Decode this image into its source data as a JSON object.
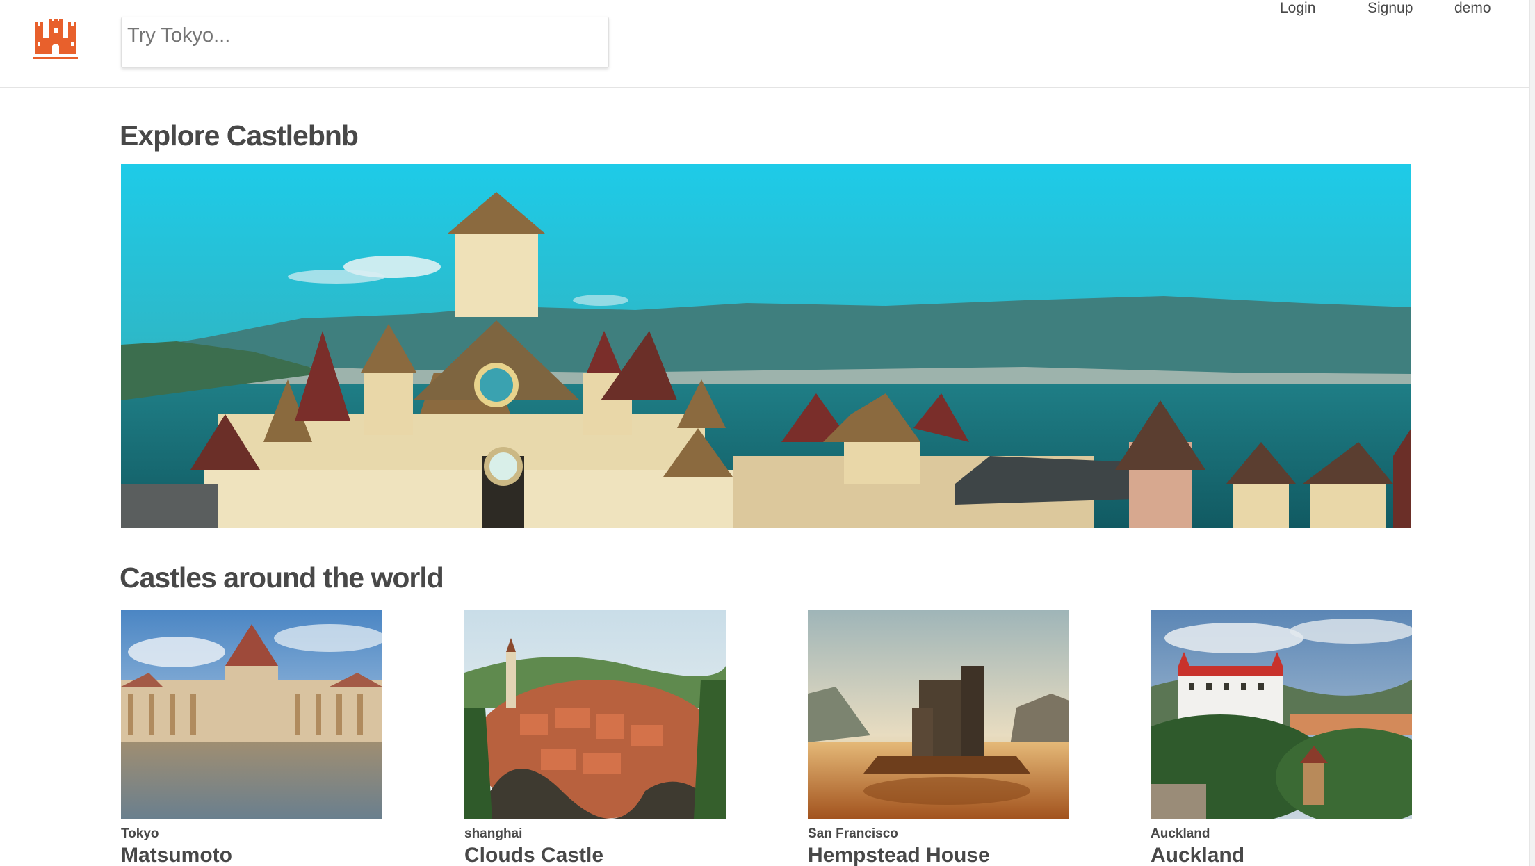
{
  "header": {
    "search_placeholder": "Try Tokyo...",
    "nav": [
      {
        "label": "Login"
      },
      {
        "label": "Signup"
      },
      {
        "label": "demo"
      }
    ]
  },
  "main": {
    "explore_title": "Explore Castlebnb",
    "castles_title": "Castles around the world",
    "listings": [
      {
        "city": "Tokyo",
        "title": "Matsumoto"
      },
      {
        "city": "shanghai",
        "title": "Clouds Castle"
      },
      {
        "city": "San Francisco",
        "title": "Hempstead House"
      },
      {
        "city": "Auckland",
        "title": "Auckland"
      }
    ]
  },
  "colors": {
    "brand": "#e8602c",
    "text": "#484848",
    "sky": "#26c4e0",
    "sea": "#17707a"
  },
  "icons": {
    "logo": "castle-logo-icon"
  }
}
